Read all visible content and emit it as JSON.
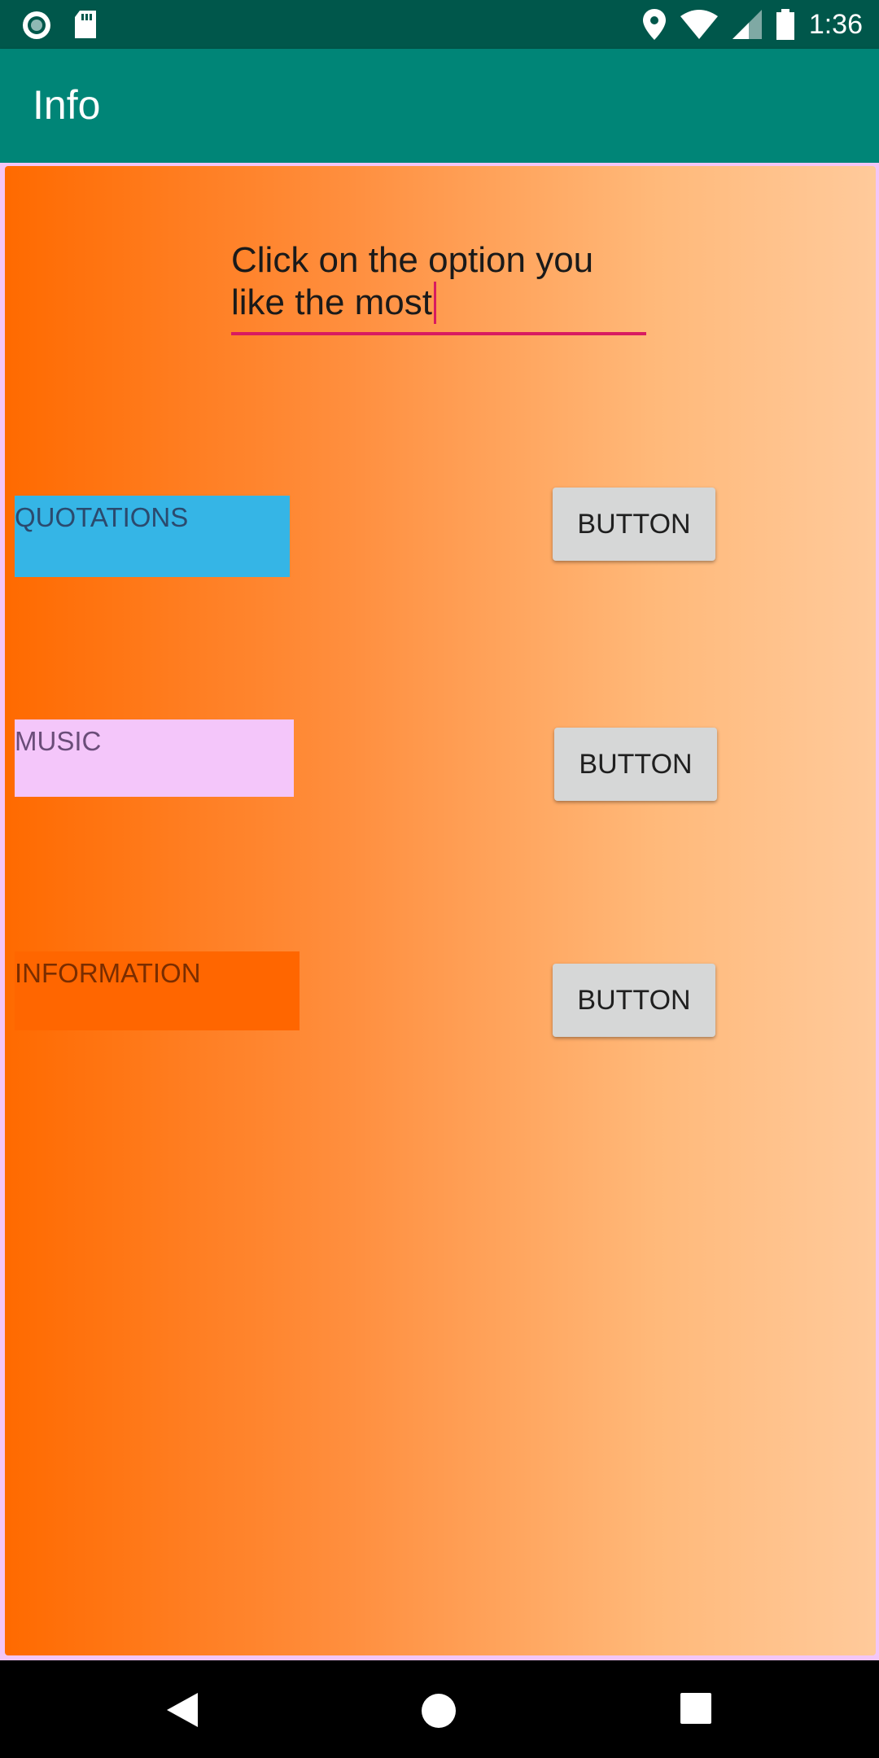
{
  "status_bar": {
    "time": "1:36",
    "left_icons": [
      "circle-notification-icon",
      "sd-card-icon"
    ],
    "right_icons": [
      "location-icon",
      "wifi-icon",
      "signal-icon",
      "battery-icon"
    ]
  },
  "app_bar": {
    "title": "Info"
  },
  "prompt": {
    "value": "Click on the option you like the most"
  },
  "options": [
    {
      "label": "QUOTATIONS",
      "button": "BUTTON",
      "color": "#35b5e6"
    },
    {
      "label": "MUSIC",
      "button": "BUTTON",
      "color": "#f4c6fa"
    },
    {
      "label": "INFORMATION",
      "button": "BUTTON",
      "color": "#ff6600"
    }
  ],
  "colors": {
    "status_bar": "#00574b",
    "app_bar": "#008577",
    "accent": "#d81b60",
    "gradient_start": "#ff6a00",
    "gradient_end": "#ffca9b"
  },
  "nav_bar": {
    "icons": [
      "back-icon",
      "home-icon",
      "recents-icon"
    ]
  }
}
